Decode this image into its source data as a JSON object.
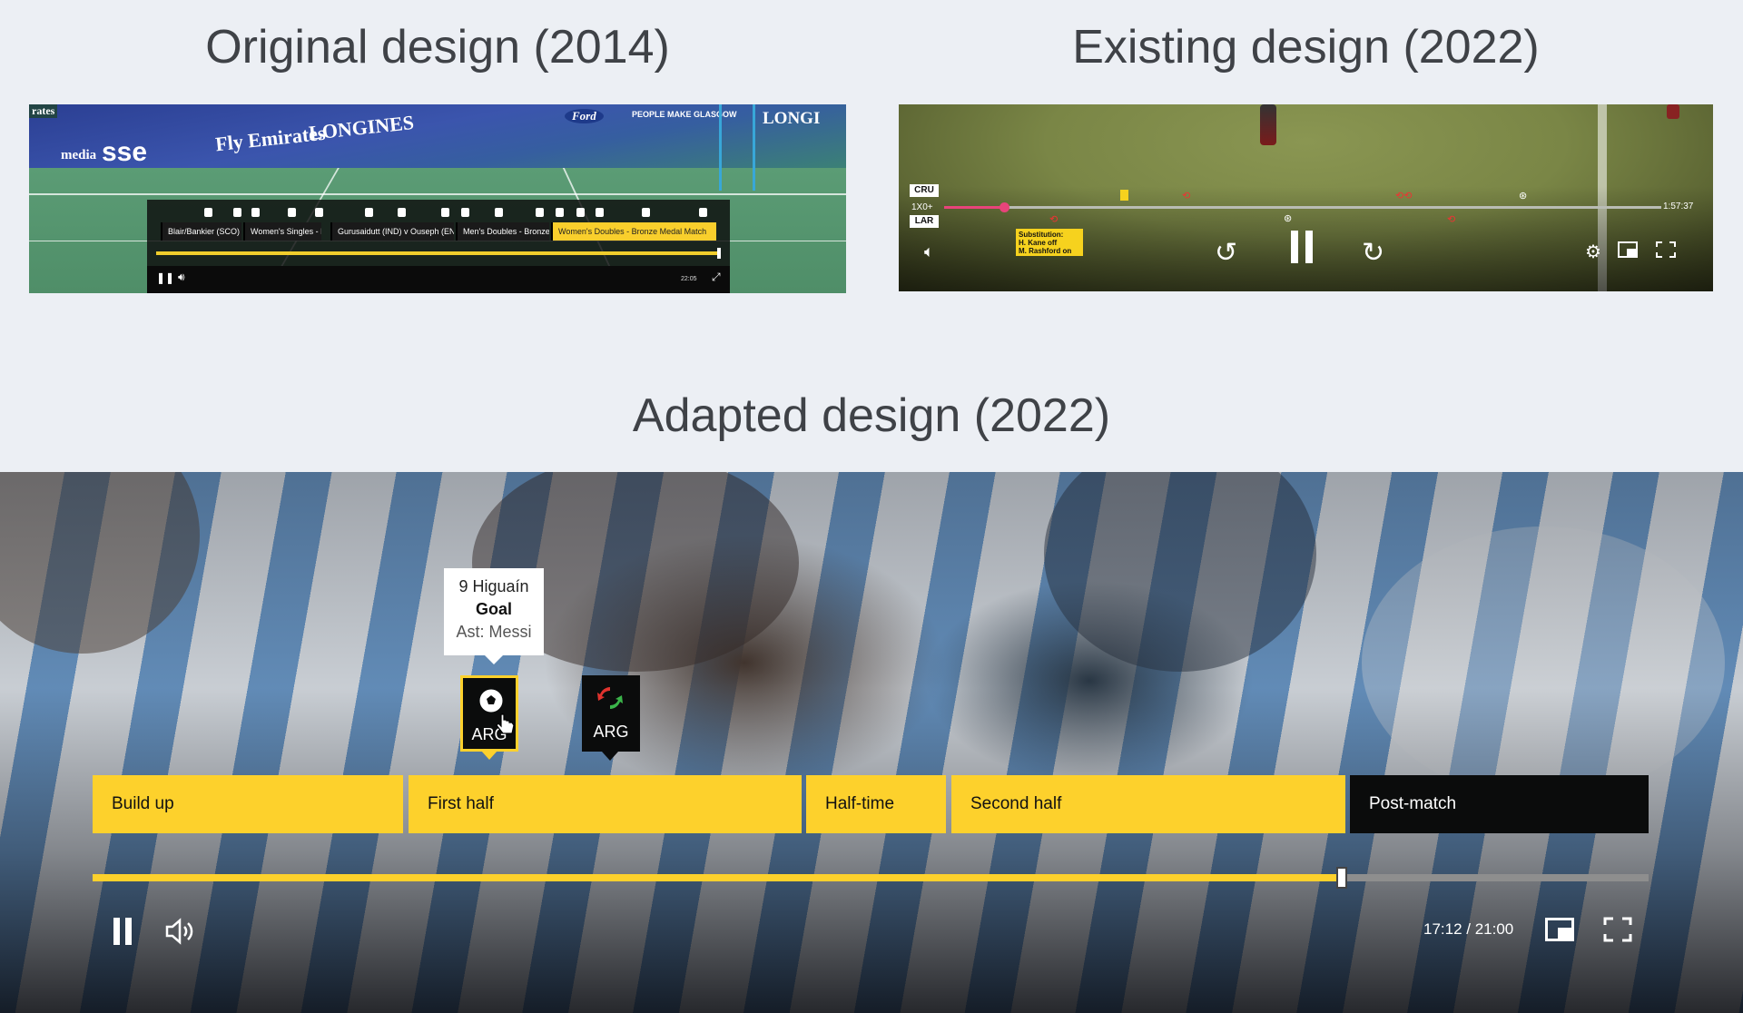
{
  "headings": {
    "original": "Original design (2014)",
    "existing": "Existing design (2022)",
    "adapted": "Adapted design (2022)"
  },
  "original_player": {
    "chapters": [
      "Blair/Bankier (SCO) v (",
      "Women's Singles - B",
      "Gurusaidutt (IND) v Ouseph (ENG)",
      "Men's Doubles - Bronze Me",
      "Women's Doubles - Bronze Medal Match"
    ],
    "active_chapter_index": 4,
    "time": "22:05",
    "brands": [
      "sse",
      "media",
      "LONGINES",
      "Ford",
      "PEOPLE MAKE GLASGOW",
      "LONGI",
      "Fly Emirates",
      "rates"
    ],
    "icons": [
      "pause-icon",
      "volume-icon",
      "fullscreen-icon"
    ]
  },
  "existing_player": {
    "home_team": "CRU",
    "away_team": "LAR",
    "score": "1X0+",
    "end_time": "1:57:37",
    "tooltip_lines": [
      "Substitution:",
      "H. Kane off",
      "M. Rashford on"
    ],
    "icons": [
      "mute-icon",
      "rewind-20-icon",
      "pause-icon",
      "forward-20-icon",
      "settings-icon",
      "pip-icon",
      "fullscreen-icon"
    ]
  },
  "adapted_player": {
    "tooltip": {
      "player": "9 Higuaín",
      "event": "Goal",
      "assist": "Ast: Messi"
    },
    "markers": [
      {
        "label": "ARG",
        "icon": "football-icon",
        "active": true
      },
      {
        "label": "ARG",
        "icon": "substitution-icon",
        "active": false
      }
    ],
    "chapters": [
      "Build up",
      "First half",
      "Half-time",
      "Second half",
      "Post-match"
    ],
    "progress": 0.803,
    "current_time": "17:12",
    "total_time": "21:00",
    "time_display": "17:12 / 21:00",
    "colors": {
      "accent": "#fdd12c",
      "dark": "#0b0c0c"
    }
  }
}
